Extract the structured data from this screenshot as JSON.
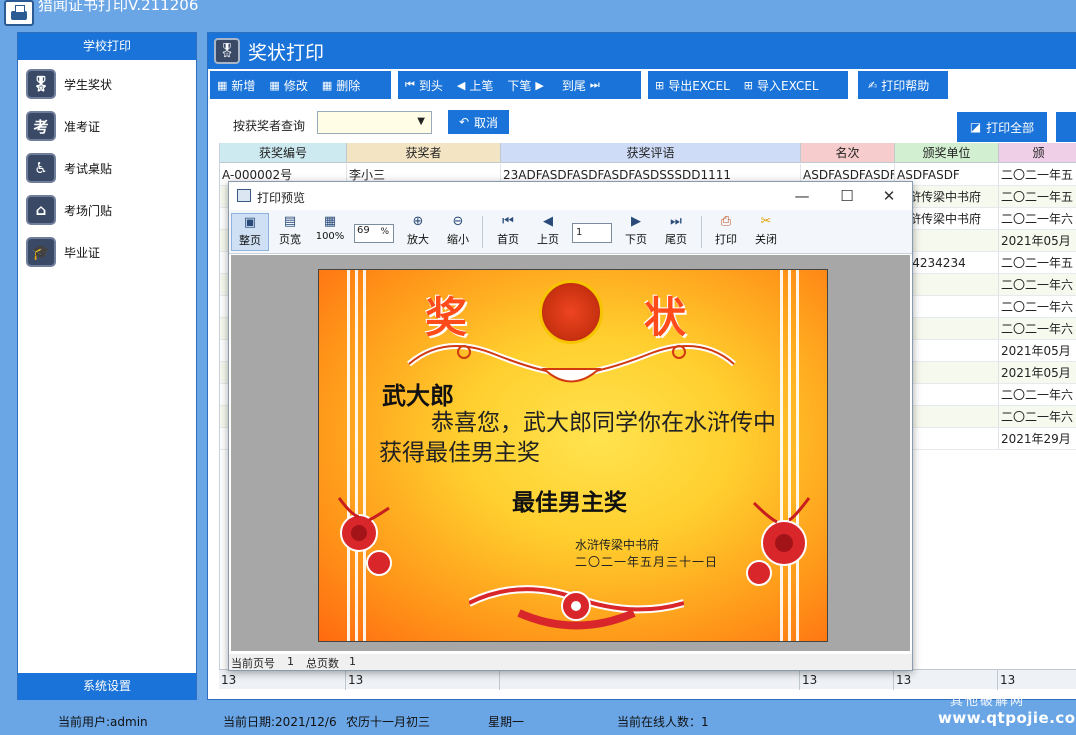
{
  "app": {
    "title": "猎闻证书打印V.211206"
  },
  "sidebar": {
    "header": "学校打印",
    "items": [
      {
        "label": "学生奖状",
        "icon": "medal-icon",
        "glyph": "🎖"
      },
      {
        "label": "准考证",
        "icon": "exam-ticket-icon",
        "glyph": "考"
      },
      {
        "label": "考试桌贴",
        "icon": "desk-seat-icon",
        "glyph": "♿"
      },
      {
        "label": "考场门贴",
        "icon": "house-icon",
        "glyph": "⌂"
      },
      {
        "label": "毕业证",
        "icon": "graduation-cap-icon",
        "glyph": "🎓"
      }
    ],
    "footer": "系统设置"
  },
  "main": {
    "title": "奖状打印",
    "toolbar": {
      "add": "新增",
      "edit": "修改",
      "delete": "删除",
      "first": "到头",
      "prev": "上笔",
      "next": "下笔",
      "last": "到尾",
      "export": "导出EXCEL",
      "import": "导入EXCEL",
      "help": "打印帮助"
    },
    "search": {
      "label": "按获奖者查询",
      "value": "",
      "cancel": "取消"
    },
    "print_all": "打印全部",
    "grid": {
      "columns": [
        "获奖编号",
        "获奖者",
        "获奖评语",
        "名次",
        "颁奖单位",
        "颁"
      ],
      "column_colors": [
        "#cdeaf0",
        "#f3e4c4",
        "#cfdcf7",
        "#f7cccc",
        "#d2efd2",
        "#efcfe8"
      ],
      "rows": [
        [
          "A-000002号",
          "李小三",
          "23ADFASDFASDFASDFASDSSSDD1111",
          "ASDFASDFASDF",
          "ASDFASDF",
          "二〇二一年五"
        ],
        [
          "",
          "",
          "",
          "",
          "水浒传梁中书府",
          "二〇二一年五"
        ],
        [
          "",
          "",
          "",
          "",
          "水浒传梁中书府",
          "二〇二一年六"
        ],
        [
          "",
          "",
          "",
          "",
          "",
          "2021年05月"
        ],
        [
          "",
          "",
          "",
          "",
          "234234234",
          "二〇二一年五"
        ],
        [
          "",
          "",
          "",
          "",
          "",
          "二〇二一年六"
        ],
        [
          "",
          "",
          "",
          "",
          "",
          "二〇二一年六"
        ],
        [
          "",
          "",
          "",
          "",
          "",
          "二〇二一年六"
        ],
        [
          "",
          "",
          "",
          "",
          "",
          "2021年05月"
        ],
        [
          "",
          "",
          "",
          "",
          "",
          "2021年05月"
        ],
        [
          "",
          "",
          "",
          "",
          "",
          "二〇二一年六"
        ],
        [
          "",
          "",
          "",
          "",
          "",
          "二〇二一年六"
        ],
        [
          "",
          "",
          "",
          "",
          "",
          "2021年29月"
        ]
      ],
      "footer": [
        "13",
        "13",
        "",
        "13",
        "13",
        "13"
      ]
    }
  },
  "preview": {
    "title": "打印预览",
    "toolbar": {
      "fit_page": "整页",
      "fit_width": "页宽",
      "actual_size": "100%",
      "zoom_value": "69",
      "zoom_unit": "%",
      "zoom_in": "放大",
      "zoom_out": "缩小",
      "first_page": "首页",
      "prev_page": "上页",
      "page_value": "1",
      "next_page": "下页",
      "last_page": "尾页",
      "print": "打印",
      "close": "关闭"
    },
    "status": {
      "current_page_label": "当前页号",
      "current_page": "1",
      "total_label": "总页数",
      "total": "1"
    },
    "certificate": {
      "title_left": "奖",
      "title_right": "状",
      "name": "武大郎",
      "body": "恭喜您，武大郎同学你在水浒传中获得最佳男主奖",
      "award": "最佳男主奖",
      "issuer": "水浒传梁中书府",
      "date": "二〇二一年五月三十一日"
    }
  },
  "statusbar": {
    "user": "当前用户:admin",
    "date": "当前日期:2021/12/6",
    "lunar": "农历十一月初三",
    "weekday": "星期一",
    "online": "当前在线人数：1"
  },
  "watermark": {
    "cn": "其他破解网",
    "url": "www.qtpojie.com"
  },
  "colors": {
    "accent": "#1a73d8",
    "background": "#6aa6e6"
  }
}
